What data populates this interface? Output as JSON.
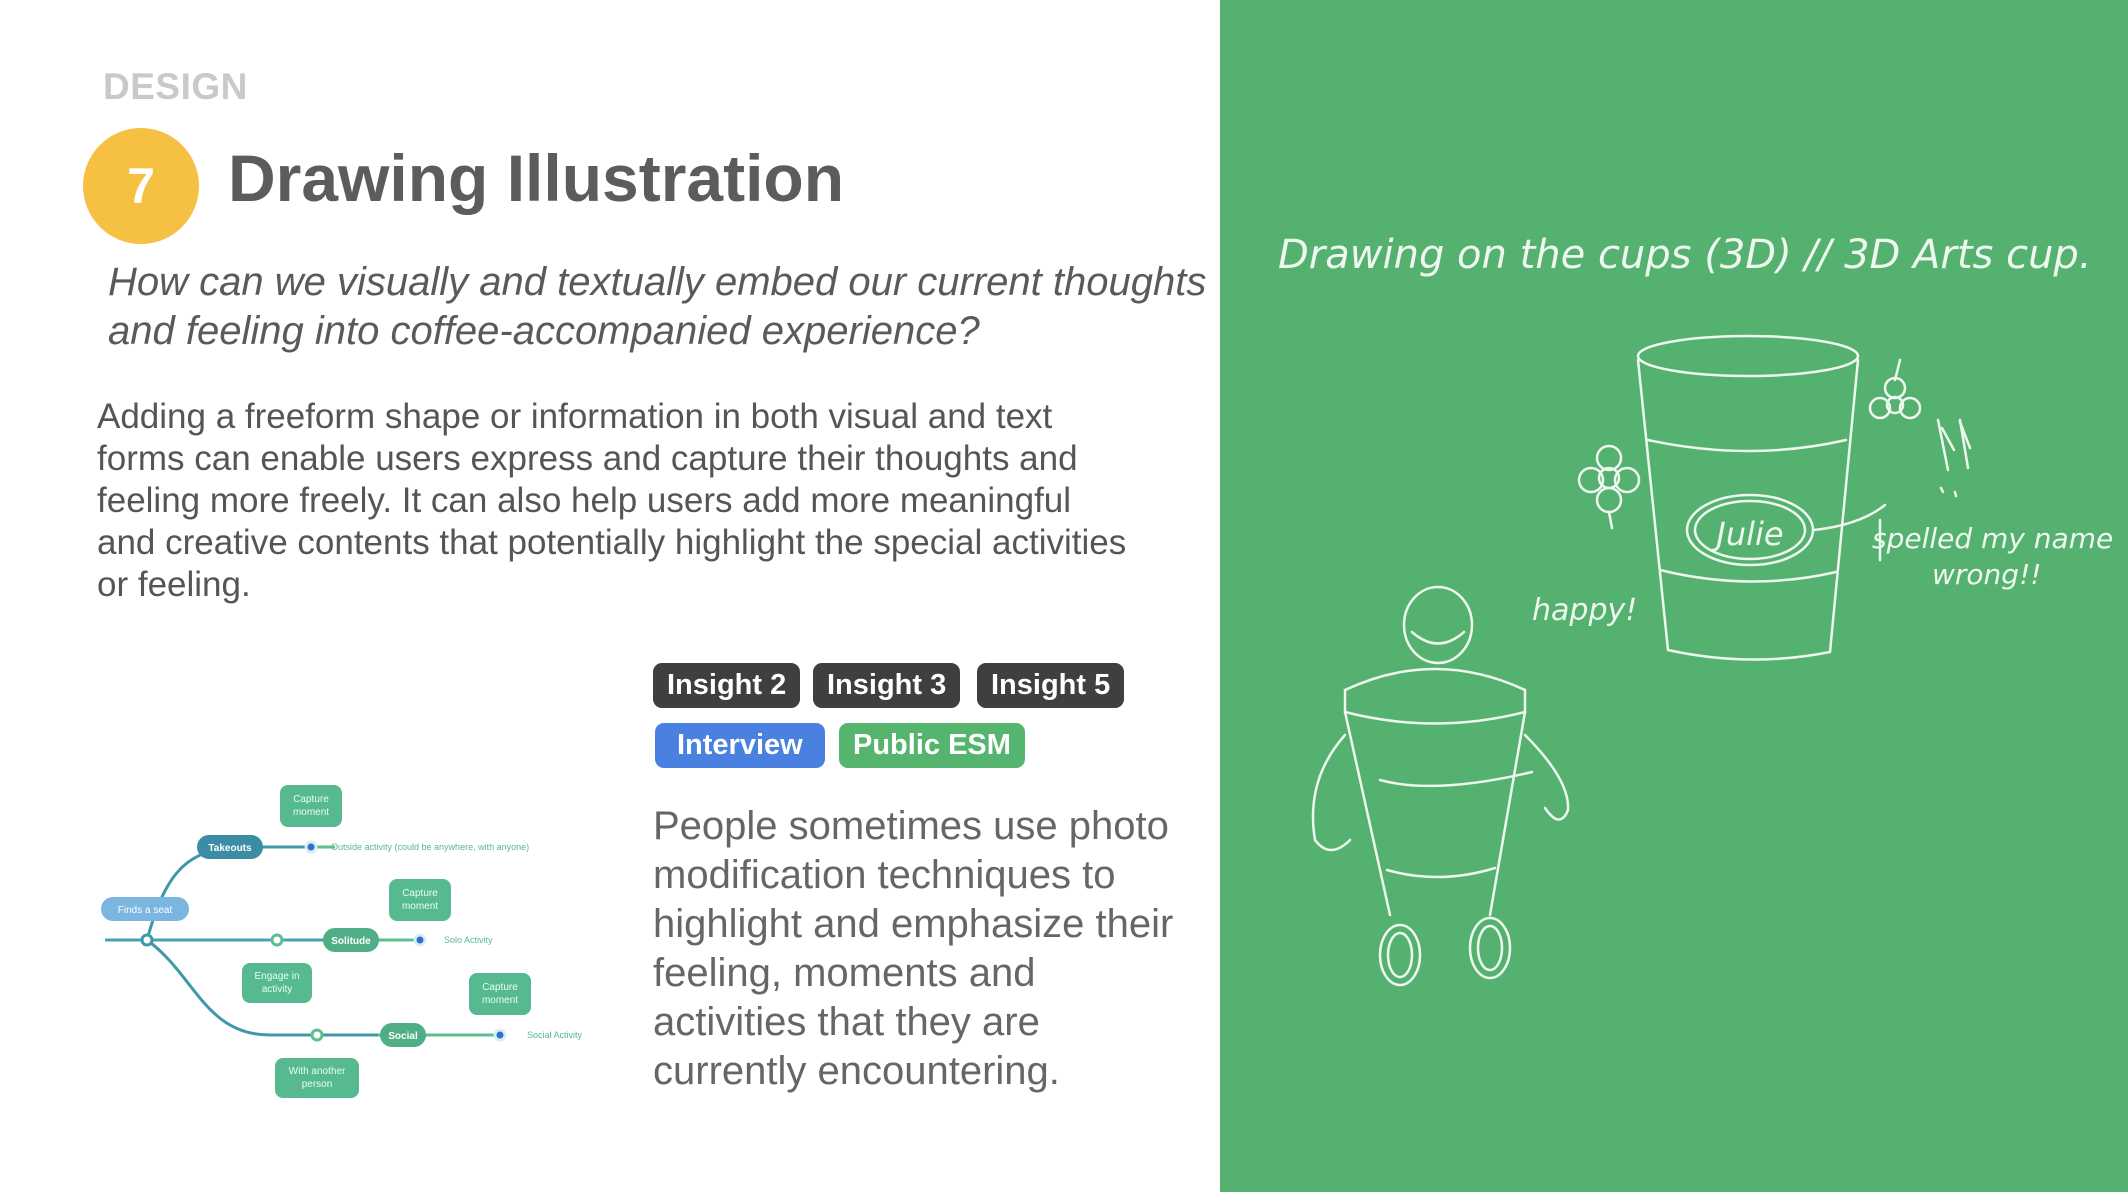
{
  "section_label": "DESIGN",
  "step_number": "7",
  "title": "Drawing Illustration",
  "question": "How can we visually and textually embed our current thoughts and feeling into coffee-accompanied experience?",
  "body": "Adding a freeform shape or information in both visual and text forms can enable users express and capture their thoughts and feeling more freely. It can also help users add more meaningful and creative contents that potentially highlight the special activities or feeling.",
  "tags": [
    {
      "label": "Insight 2",
      "color": "#3f3f3f"
    },
    {
      "label": "Insight 3",
      "color": "#3f3f3f"
    },
    {
      "label": "Insight 5",
      "color": "#3f3f3f"
    },
    {
      "label": "Interview",
      "color": "#4a80e0"
    },
    {
      "label": "Public ESM",
      "color": "#55b56f"
    }
  ],
  "people_text": "People sometimes use photo modification techniques to highlight and emphasize their feeling, moments and activities that they are currently encountering.",
  "diagram": {
    "takeouts": "Takeouts",
    "finds_seat": "Finds a seat",
    "solitude": "Solitude",
    "social": "Social",
    "engage": [
      "Engage in",
      "activity"
    ],
    "with_another": [
      "With another",
      "person"
    ],
    "capture": [
      "Capture",
      "moment"
    ],
    "outside_activity": "Outside activity (could be anywhere, with anyone)",
    "solo_activity": "Solo Activity",
    "social_activity": "Social Activity"
  },
  "sketch": {
    "caption": "Drawing on the cups (3D) // 3D Arts cup.",
    "name_on_cup": "Julie",
    "note_line1": "spelled my name",
    "note_line2": "wrong!!",
    "happy": "happy!"
  },
  "colors": {
    "badge": "#f6c042",
    "panel_green": "#55b170",
    "teal": "#3f97aa",
    "mint": "#56b98f"
  }
}
